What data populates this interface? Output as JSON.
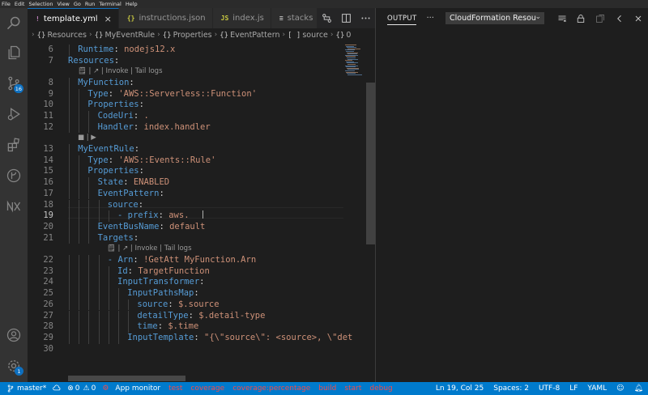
{
  "menu": [
    "File",
    "Edit",
    "Selection",
    "View",
    "Go",
    "Run",
    "Terminal",
    "Help"
  ],
  "activity": {
    "scm_badge": "16",
    "settings_badge": "1"
  },
  "tabs": [
    {
      "icon": "!",
      "label": "template.yml",
      "active": true,
      "close": "×"
    },
    {
      "icon": "{}",
      "label": "instructions.json",
      "active": false
    },
    {
      "icon": "JS",
      "label": "index.js",
      "active": false
    },
    {
      "icon": "≡",
      "label": "stacks",
      "active": false
    }
  ],
  "breadcrumb": [
    {
      "icon": "{}",
      "label": "Resources"
    },
    {
      "icon": "{}",
      "label": "MyEventRule"
    },
    {
      "icon": "{}",
      "label": "Properties"
    },
    {
      "icon": "{}",
      "label": "EventPattern"
    },
    {
      "icon": "[ ]",
      "label": "source"
    },
    {
      "icon": "{}",
      "label": "0"
    }
  ],
  "code_lens": {
    "function": "| ↗ | Invoke | Tail logs",
    "rule": "■ | ▶",
    "targets": "| ↗ | Invoke | Tail logs"
  },
  "code": [
    {
      "n": "6",
      "indent": 1,
      "key": "Runtime",
      "val": "nodejs12.x"
    },
    {
      "n": "7",
      "indent": 0,
      "key": "Resources",
      "val": ""
    },
    {
      "n": "8",
      "indent": 1,
      "key": "MyFunction",
      "val": ""
    },
    {
      "n": "9",
      "indent": 2,
      "key": "Type",
      "val": "'AWS::Serverless::Function'"
    },
    {
      "n": "10",
      "indent": 2,
      "key": "Properties",
      "val": ""
    },
    {
      "n": "11",
      "indent": 3,
      "key": "CodeUri",
      "val": "."
    },
    {
      "n": "12",
      "indent": 3,
      "key": "Handler",
      "val": "index.handler"
    },
    {
      "n": "13",
      "indent": 1,
      "key": "MyEventRule",
      "val": ""
    },
    {
      "n": "14",
      "indent": 2,
      "key": "Type",
      "val": "'AWS::Events::Rule'"
    },
    {
      "n": "15",
      "indent": 2,
      "key": "Properties",
      "val": ""
    },
    {
      "n": "16",
      "indent": 3,
      "key": "State",
      "val": "ENABLED"
    },
    {
      "n": "17",
      "indent": 3,
      "key": "EventPattern",
      "val": ""
    },
    {
      "n": "18",
      "indent": 4,
      "key": "source",
      "val": ""
    },
    {
      "n": "19",
      "indent": 5,
      "key": "- prefix",
      "val": "aws."
    },
    {
      "n": "20",
      "indent": 3,
      "key": "EventBusName",
      "val": "default"
    },
    {
      "n": "21",
      "indent": 3,
      "key": "Targets",
      "val": ""
    },
    {
      "n": "22",
      "indent": 4,
      "key": "- Arn",
      "val": "!GetAtt MyFunction.Arn"
    },
    {
      "n": "23",
      "indent": 5,
      "key": "Id",
      "val": "TargetFunction"
    },
    {
      "n": "24",
      "indent": 5,
      "key": "InputTransformer",
      "val": ""
    },
    {
      "n": "25",
      "indent": 6,
      "key": "InputPathsMap",
      "val": ""
    },
    {
      "n": "26",
      "indent": 7,
      "key": "source",
      "val": "$.source"
    },
    {
      "n": "27",
      "indent": 7,
      "key": "detailType",
      "val": "$.detail-type"
    },
    {
      "n": "28",
      "indent": 7,
      "key": "time",
      "val": "$.time"
    },
    {
      "n": "29",
      "indent": 6,
      "key": "InputTemplate",
      "val": "\"{\\\"source\\\": <source>, \\\"det"
    },
    {
      "n": "30",
      "indent": 0,
      "key": "",
      "val": ""
    }
  ],
  "panel": {
    "tab": "OUTPUT",
    "more": "···",
    "channel": "CloudFormation Resou"
  },
  "status": {
    "branch": "master*",
    "problems": "0",
    "warnings": "0",
    "app_monitor": "App monitor",
    "red_items": [
      "test",
      "coverage",
      "coverage:percentage",
      "build",
      "start",
      "debug"
    ],
    "position": "Ln 19, Col 25",
    "spaces": "Spaces: 2",
    "encoding": "UTF-8",
    "eol": "LF",
    "language": "YAML"
  },
  "colors": {
    "accent": "#007acc",
    "keyword": "#569cd6",
    "string": "#ce9178",
    "error_red": "#f14c4c"
  }
}
